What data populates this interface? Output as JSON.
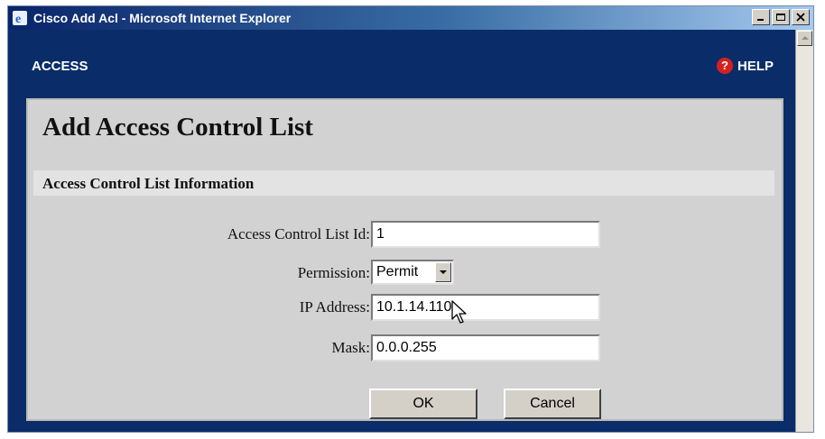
{
  "window": {
    "title": "Cisco Add Acl - Microsoft Internet Explorer"
  },
  "header": {
    "nav_label": "ACCESS",
    "help_label": "HELP"
  },
  "page": {
    "title": "Add Access Control List",
    "section_title": "Access Control List Information"
  },
  "form": {
    "acl_id": {
      "label": "Access Control List Id:",
      "value": "1"
    },
    "permission": {
      "label": "Permission:",
      "selected": "Permit"
    },
    "ip_address": {
      "label": "IP Address:",
      "value": "10.1.14.110"
    },
    "mask": {
      "label": "Mask:",
      "value": "0.0.0.255"
    }
  },
  "buttons": {
    "ok": "OK",
    "cancel": "Cancel"
  },
  "colors": {
    "window_bg": "#0a2d69",
    "panel_bg": "#d2d2d2",
    "section_bg": "#e3e3e3",
    "help_icon": "#d62020"
  }
}
